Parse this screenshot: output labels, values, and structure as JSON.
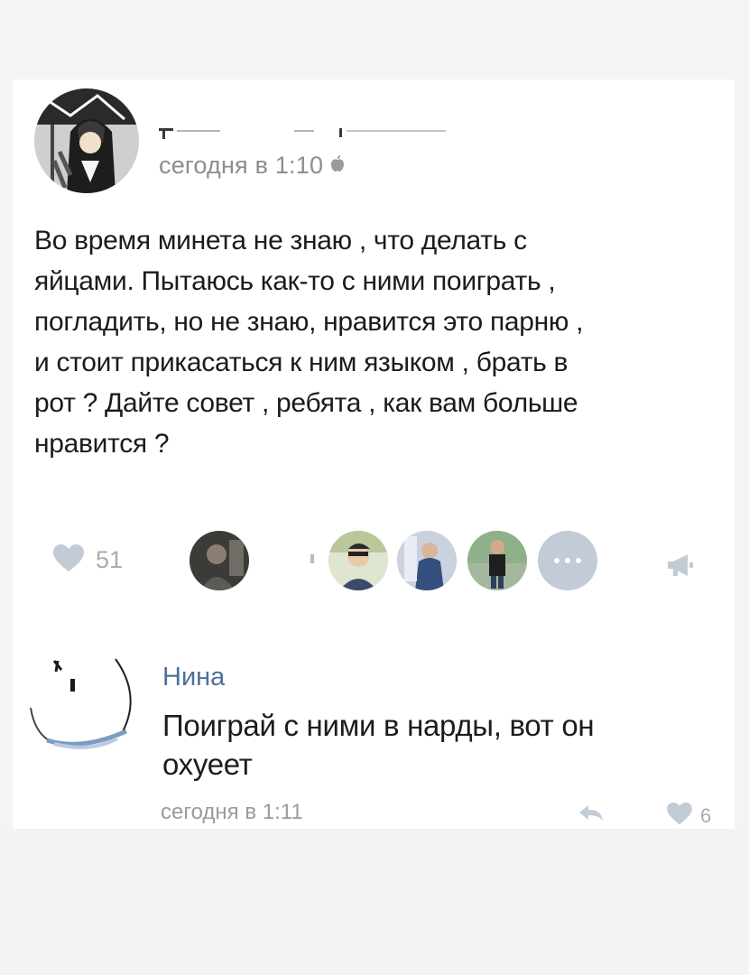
{
  "post": {
    "author_name": "",
    "date": "сегодня в 1:10",
    "platform_icon": "apple-icon",
    "text_lines": [
      "Во время минета не знаю , что делать с",
      "яйцами. Пытаюсь как-то с ними поиграть ,",
      "погладить, но не знаю, нравится это парню ,",
      "и стоит прикасаться к ним языком , брать в",
      "рот ? Дайте совет , ребята , как вам больше",
      "нравится ?"
    ],
    "likes_count": "51",
    "likers": [
      "liker-1",
      "liker-2",
      "liker-3",
      "liker-4",
      "liker-5"
    ],
    "more_likers_icon": "ellipsis-icon",
    "share_icon": "megaphone-icon"
  },
  "comment": {
    "author": "Нина",
    "text_lines": [
      "Поиграй с ними в нарды, вот он",
      "охуеет"
    ],
    "date": "сегодня в 1:11",
    "likes_count": "6",
    "reply_icon": "reply-arrow-icon"
  },
  "colors": {
    "background": "#f4f4f4",
    "card": "#ffffff",
    "link_blue": "#4d7199",
    "muted_gray": "#9b9b9b",
    "icon_gray": "#c3cbd6"
  }
}
